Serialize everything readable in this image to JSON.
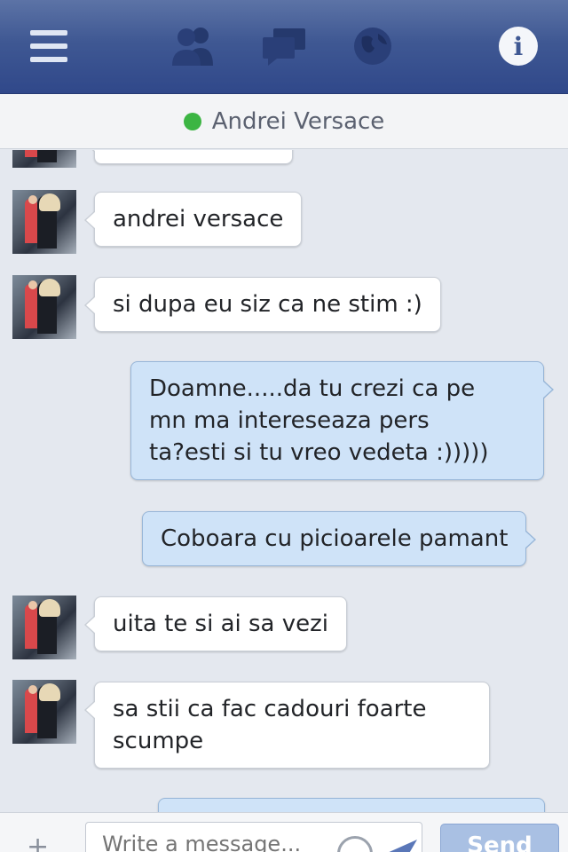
{
  "navbar": {
    "icons": [
      "menu-icon",
      "friends-icon",
      "messages-icon",
      "globe-icon",
      "info-icon"
    ],
    "info_label": "i",
    "color": "#3f5893"
  },
  "chat": {
    "contact_name": "Andrei Versace",
    "presence_color": "#3cb543"
  },
  "messages": [
    {
      "direction": "in",
      "text": "andrei versace"
    },
    {
      "direction": "in",
      "text": "si dupa eu siz ca ne stim :)"
    },
    {
      "direction": "out",
      "text": "Doamne.....da tu crezi ca pe\nmn ma intereseaza pers\nta?esti si tu vreo vedeta :)))))"
    },
    {
      "direction": "out",
      "text": "Coboara cu picioarele pamant"
    },
    {
      "direction": "in",
      "text": "uita te si ai sa vezi"
    },
    {
      "direction": "in",
      "text": "sa stii ca fac cadouri foarte\nscumpe"
    }
  ],
  "composer": {
    "placeholder": "Write a message...",
    "send_label": "Send"
  }
}
